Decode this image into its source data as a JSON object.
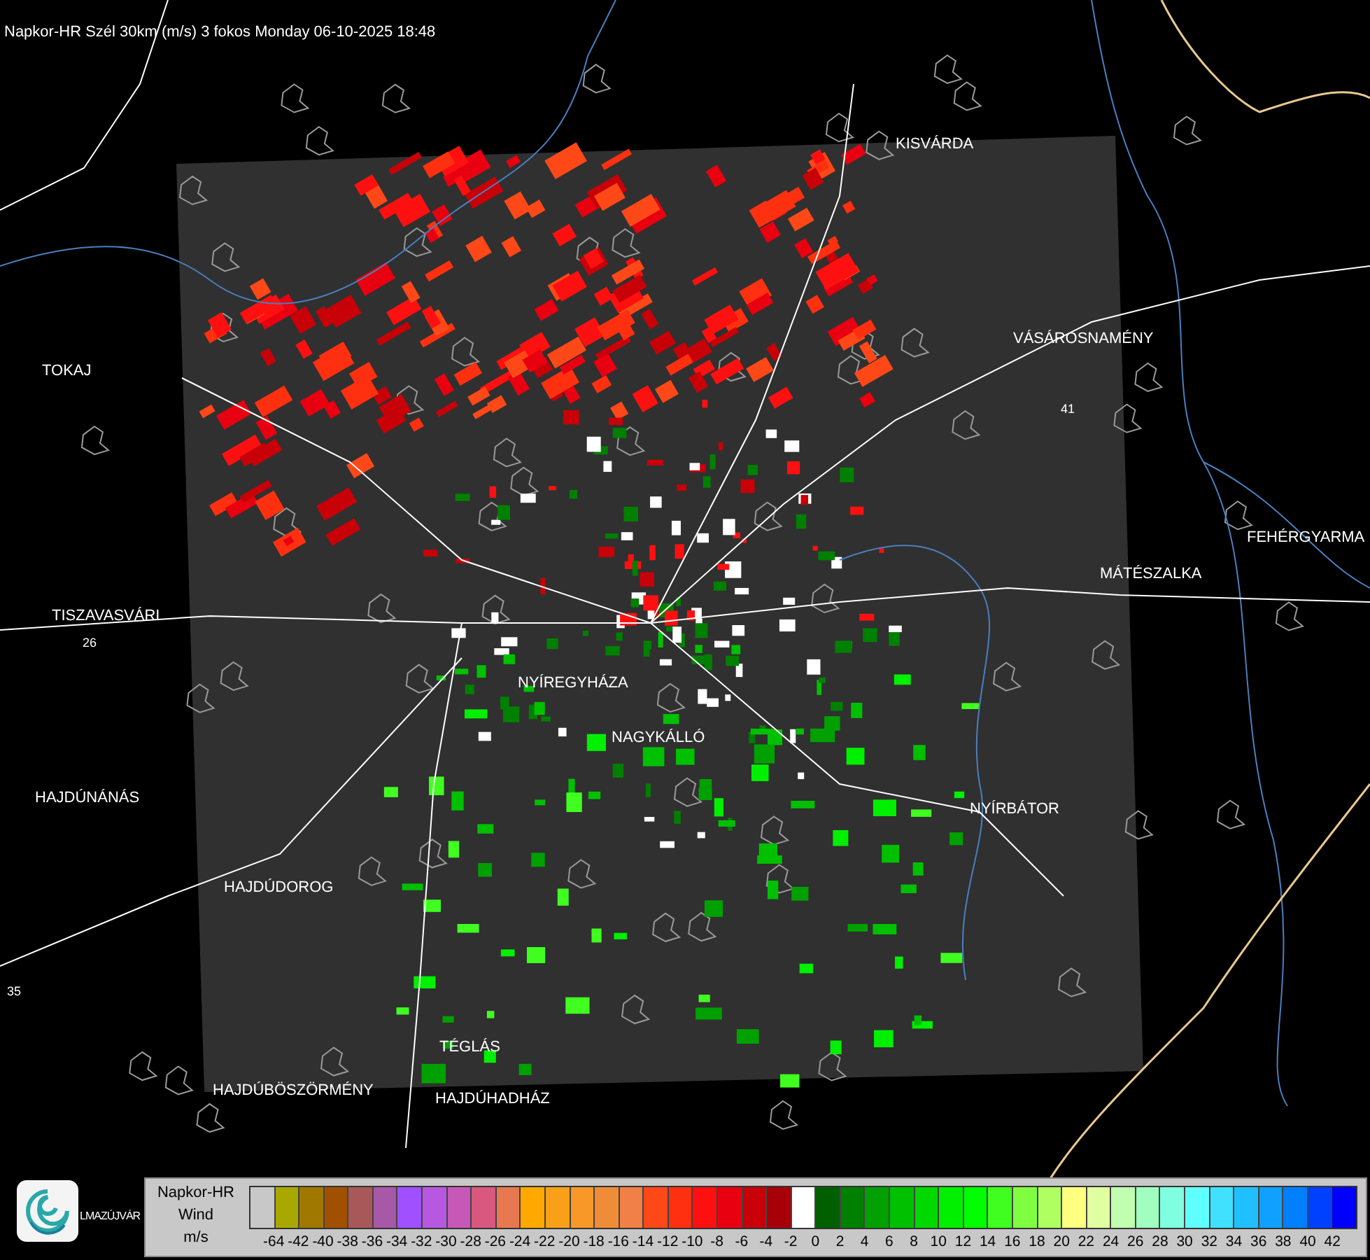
{
  "title": "Napkor-HR Szél 30km (m/s) 3 fokos Monday 06-10-2025 18:48",
  "map": {
    "places": [
      {
        "name": "KISVÁRDA"
      },
      {
        "name": "VÁSÁROSNAMÉNY"
      },
      {
        "name": "FEHÉRGYARMA"
      },
      {
        "name": "MÁTÉSZALKA"
      },
      {
        "name": "NYÍRBÁTOR"
      },
      {
        "name": "TOKAJ"
      },
      {
        "name": "TISZAVASVÁRI"
      },
      {
        "name": "NYÍREGYHÁZA"
      },
      {
        "name": "NAGYKÁLLÓ"
      },
      {
        "name": "HAJDÚNÁNÁS"
      },
      {
        "name": "HAJDÚDOROG"
      },
      {
        "name": "TÉGLÁS"
      },
      {
        "name": "HAJDÚBÖSZÖRMÉNY"
      },
      {
        "name": "HAJDÚHADHÁZ"
      },
      {
        "name": "LMAZÚJVÁR"
      }
    ],
    "road_numbers": [
      "26",
      "41",
      "35"
    ]
  },
  "legend": {
    "product": "Napkor-HR",
    "quantity": "Wind",
    "unit": "m/s",
    "cells": [
      {
        "color": "#c8c8c8"
      },
      {
        "color": "#a8a800"
      },
      {
        "color": "#a07800"
      },
      {
        "color": "#a05000"
      },
      {
        "color": "#a85858"
      },
      {
        "color": "#a858a8"
      },
      {
        "color": "#a050ff"
      },
      {
        "color": "#b858e0"
      },
      {
        "color": "#c858b8"
      },
      {
        "color": "#d85880"
      },
      {
        "color": "#e87850"
      },
      {
        "color": "#ffa800"
      },
      {
        "color": "#f8a018"
      },
      {
        "color": "#f89828"
      },
      {
        "color": "#f08c38"
      },
      {
        "color": "#f08048"
      },
      {
        "color": "#ff4818"
      },
      {
        "color": "#ff3010"
      },
      {
        "color": "#ff1010"
      },
      {
        "color": "#e80010"
      },
      {
        "color": "#c80008"
      },
      {
        "color": "#a80008"
      },
      {
        "color": "#ffffff"
      },
      {
        "color": "#006000"
      },
      {
        "color": "#008000"
      },
      {
        "color": "#00a000"
      },
      {
        "color": "#00c000"
      },
      {
        "color": "#00d800"
      },
      {
        "color": "#00f000"
      },
      {
        "color": "#00ff00"
      },
      {
        "color": "#40ff20"
      },
      {
        "color": "#80ff40"
      },
      {
        "color": "#b0ff60"
      },
      {
        "color": "#ffff80"
      },
      {
        "color": "#e0ffa0"
      },
      {
        "color": "#c0ffb0"
      },
      {
        "color": "#a0ffc0"
      },
      {
        "color": "#80ffe0"
      },
      {
        "color": "#60ffff"
      },
      {
        "color": "#40e0ff"
      },
      {
        "color": "#20c0ff"
      },
      {
        "color": "#10a0ff"
      },
      {
        "color": "#0080ff"
      },
      {
        "color": "#0040ff"
      },
      {
        "color": "#0000ff"
      }
    ],
    "ticks": [
      "-64",
      "-42",
      "-40",
      "-38",
      "-36",
      "-34",
      "-32",
      "-30",
      "-28",
      "-26",
      "-24",
      "-22",
      "-20",
      "-18",
      "-16",
      "-14",
      "-12",
      "-10",
      "-8",
      "-6",
      "-4",
      "-2",
      "0",
      "2",
      "4",
      "6",
      "8",
      "10",
      "12",
      "14",
      "16",
      "18",
      "20",
      "22",
      "24",
      "26",
      "28",
      "30",
      "32",
      "34",
      "36",
      "38",
      "40",
      "42"
    ]
  }
}
